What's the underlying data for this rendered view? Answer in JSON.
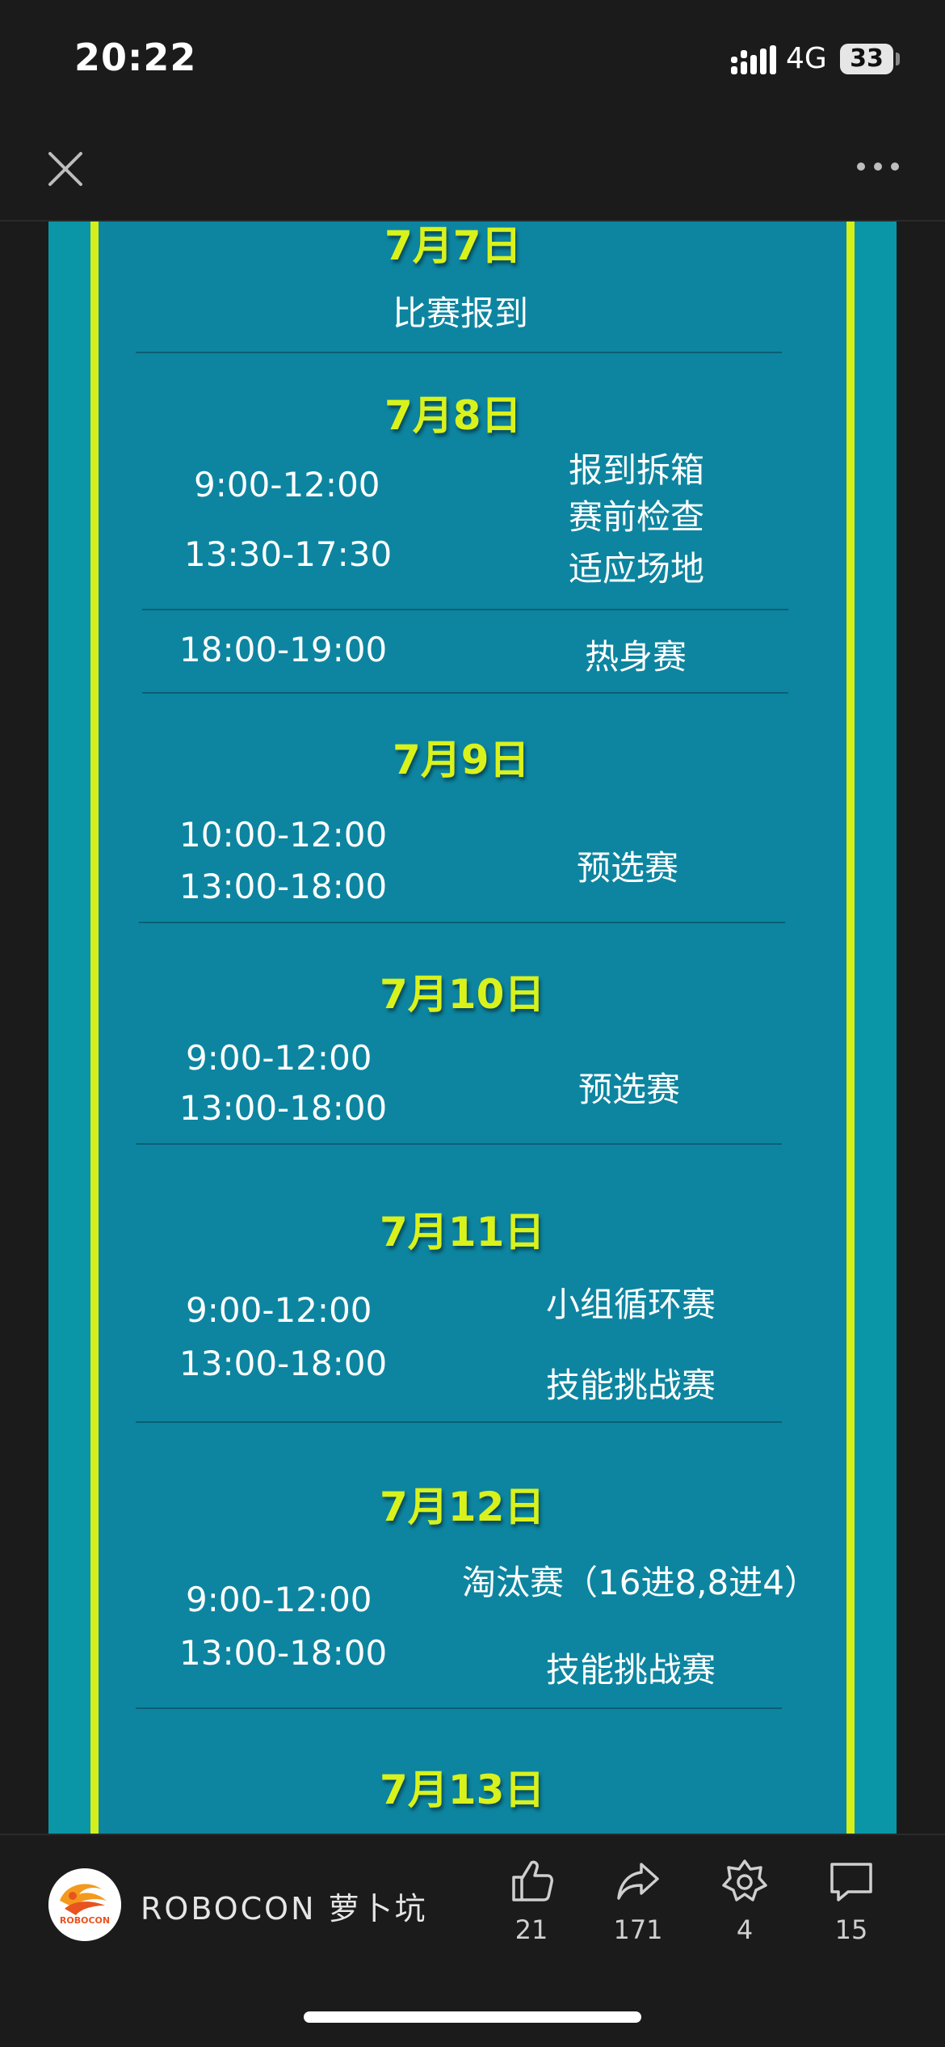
{
  "status_bar": {
    "time": "20:22",
    "network": "4G",
    "battery": "33"
  },
  "schedule": [
    {
      "date": "7月7日",
      "rows": [
        {
          "time": "",
          "event": "比赛报到"
        }
      ]
    },
    {
      "date": "7月8日",
      "rows": [
        {
          "time": "9:00-12:00",
          "events": [
            "报到拆箱",
            "赛前检查"
          ]
        },
        {
          "time": "13:30-17:30",
          "event": "适应场地"
        },
        {
          "time": "18:00-19:00",
          "event": "热身赛"
        }
      ]
    },
    {
      "date": "7月9日",
      "times": [
        "10:00-12:00",
        "13:00-18:00"
      ],
      "event": "预选赛"
    },
    {
      "date": "7月10日",
      "times": [
        "9:00-12:00",
        "13:00-18:00"
      ],
      "event": "预选赛"
    },
    {
      "date": "7月11日",
      "times": [
        "9:00-12:00",
        "13:00-18:00"
      ],
      "events": [
        "小组循环赛",
        "技能挑战赛"
      ]
    },
    {
      "date": "7月12日",
      "times": [
        "9:00-12:00",
        "13:00-18:00"
      ],
      "events": [
        "淘汰赛（16进8,8进4）",
        "技能挑战赛"
      ]
    },
    {
      "date": "7月13日"
    }
  ],
  "footer": {
    "avatar_text": "ROBOCON",
    "author": "ROBOCON 萝卜坑",
    "like_count": "21",
    "share_count": "171",
    "favorite_count": "4",
    "comment_count": "15"
  },
  "icons": [
    "close-icon",
    "more-icon",
    "signal-icon",
    "like-icon",
    "share-icon",
    "favorite-icon",
    "comment-icon"
  ],
  "colors": {
    "panel": "#0a96a6",
    "inner": "#0d85a0",
    "accent": "#d4ef1a",
    "background": "#1b1b1c"
  }
}
